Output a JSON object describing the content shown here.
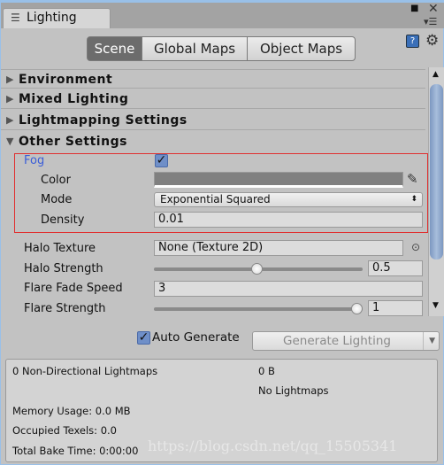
{
  "window": {
    "tab_title": "Lighting",
    "icons": [
      "sliders-icon",
      "maximize-icon",
      "close-icon",
      "menu-icon",
      "help-book-icon",
      "gear-icon"
    ]
  },
  "toolbar": {
    "tabs": [
      {
        "label": "Scene",
        "active": true
      },
      {
        "label": "Global Maps",
        "active": false
      },
      {
        "label": "Object Maps",
        "active": false
      }
    ]
  },
  "sections": [
    {
      "label": "Environment",
      "expanded": false
    },
    {
      "label": "Mixed Lighting",
      "expanded": false
    },
    {
      "label": "Lightmapping Settings",
      "expanded": false
    },
    {
      "label": "Other Settings",
      "expanded": true
    }
  ],
  "fog": {
    "label": "Fog",
    "enabled": true,
    "color_label": "Color",
    "color_value": "#808080",
    "mode_label": "Mode",
    "mode_value": "Exponential Squared",
    "density_label": "Density",
    "density_value": "0.01",
    "highlight_color": "#e03030",
    "label_color": "#3b5ed8"
  },
  "halo": {
    "texture_label": "Halo Texture",
    "texture_value": "None (Texture 2D)",
    "strength_label": "Halo Strength",
    "strength_value": "0.5",
    "strength_fraction": 0.5
  },
  "flare": {
    "fade_label": "Flare Fade Speed",
    "fade_value": "3",
    "strength_label": "Flare Strength",
    "strength_value": "1",
    "strength_fraction": 1.0
  },
  "bake": {
    "auto_generate_label": "Auto Generate",
    "auto_generate": true,
    "generate_label": "Generate Lighting"
  },
  "info": {
    "lightmaps": "0 Non-Directional Lightmaps",
    "size": "0 B",
    "no_lightmaps": "No Lightmaps",
    "memory": "Memory Usage: 0.0 MB",
    "texels": "Occupied Texels: 0.0",
    "bake_time": "Total Bake Time: 0:00:00"
  },
  "watermark": "https://blog.csdn.net/qq_15505341"
}
